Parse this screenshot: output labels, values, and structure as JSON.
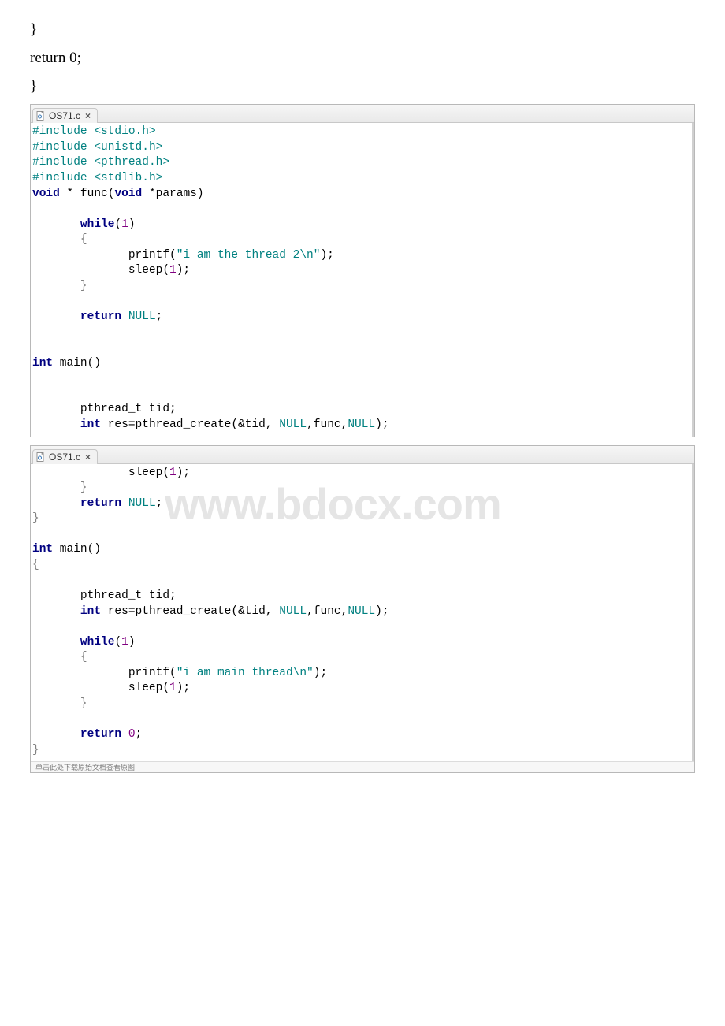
{
  "prose": {
    "line1": "}",
    "line2": "return 0;",
    "line3": "}"
  },
  "tab": {
    "filename": "OS71.c",
    "close_glyph": "×"
  },
  "watermark": "www.bdocx.com",
  "bottom_status": "单击此处下载原始文档查看原图",
  "panel1": {
    "tokens": [
      [
        [
          "pp",
          "#include"
        ],
        [
          "ident",
          " "
        ],
        [
          "hdr",
          "<stdio.h>"
        ]
      ],
      [
        [
          "pp",
          "#include"
        ],
        [
          "ident",
          " "
        ],
        [
          "hdr",
          "<unistd.h>"
        ]
      ],
      [
        [
          "pp",
          "#include"
        ],
        [
          "ident",
          " "
        ],
        [
          "hdr",
          "<pthread.h>"
        ]
      ],
      [
        [
          "pp",
          "#include"
        ],
        [
          "ident",
          " "
        ],
        [
          "hdr",
          "<stdlib.h>"
        ]
      ],
      [
        [
          "kw",
          "void"
        ],
        [
          "ident",
          " * func("
        ],
        [
          "kw",
          "void"
        ],
        [
          "ident",
          " *params)"
        ]
      ],
      [
        [
          "ident",
          ""
        ]
      ],
      [
        [
          "ident",
          "       "
        ],
        [
          "kw",
          "while"
        ],
        [
          "ident",
          "("
        ],
        [
          "num",
          "1"
        ],
        [
          "ident",
          ")"
        ]
      ],
      [
        [
          "ident",
          "       "
        ],
        [
          "brace",
          "{"
        ]
      ],
      [
        [
          "ident",
          "              printf("
        ],
        [
          "str",
          "\"i am the thread 2\\n\""
        ],
        [
          "ident",
          ");"
        ]
      ],
      [
        [
          "ident",
          "              sleep("
        ],
        [
          "num",
          "1"
        ],
        [
          "ident",
          ");"
        ]
      ],
      [
        [
          "ident",
          "       "
        ],
        [
          "brace",
          "}"
        ]
      ],
      [
        [
          "ident",
          ""
        ]
      ],
      [
        [
          "ident",
          "       "
        ],
        [
          "kw",
          "return"
        ],
        [
          "ident",
          " "
        ],
        [
          "nullkw",
          "NULL"
        ],
        [
          "ident",
          ";"
        ]
      ],
      [
        [
          "ident",
          ""
        ]
      ],
      [
        [
          "ident",
          ""
        ]
      ],
      [
        [
          "kw",
          "int"
        ],
        [
          "ident",
          " main()"
        ]
      ],
      [
        [
          "ident",
          ""
        ]
      ],
      [
        [
          "ident",
          ""
        ]
      ],
      [
        [
          "ident",
          "       pthread_t tid;"
        ]
      ],
      [
        [
          "ident",
          "       "
        ],
        [
          "kw",
          "int"
        ],
        [
          "ident",
          " res=pthread_create(&tid, "
        ],
        [
          "nullkw",
          "NULL"
        ],
        [
          "ident",
          ",func,"
        ],
        [
          "nullkw",
          "NULL"
        ],
        [
          "ident",
          ");"
        ]
      ]
    ]
  },
  "panel2": {
    "tokens": [
      [
        [
          "ident",
          "              sleep("
        ],
        [
          "num",
          "1"
        ],
        [
          "ident",
          ");"
        ]
      ],
      [
        [
          "ident",
          "       "
        ],
        [
          "brace",
          "}"
        ]
      ],
      [
        [
          "ident",
          "       "
        ],
        [
          "kw",
          "return"
        ],
        [
          "ident",
          " "
        ],
        [
          "nullkw",
          "NULL"
        ],
        [
          "ident",
          ";"
        ]
      ],
      [
        [
          "brace",
          "}"
        ]
      ],
      [
        [
          "ident",
          ""
        ]
      ],
      [
        [
          "kw",
          "int"
        ],
        [
          "ident",
          " main()"
        ]
      ],
      [
        [
          "brace",
          "{"
        ]
      ],
      [
        [
          "ident",
          ""
        ]
      ],
      [
        [
          "ident",
          "       pthread_t tid;"
        ]
      ],
      [
        [
          "ident",
          "       "
        ],
        [
          "kw",
          "int"
        ],
        [
          "ident",
          " res=pthread_create(&tid, "
        ],
        [
          "nullkw",
          "NULL"
        ],
        [
          "ident",
          ",func,"
        ],
        [
          "nullkw",
          "NULL"
        ],
        [
          "ident",
          ");"
        ]
      ],
      [
        [
          "ident",
          ""
        ]
      ],
      [
        [
          "ident",
          "       "
        ],
        [
          "kw",
          "while"
        ],
        [
          "ident",
          "("
        ],
        [
          "num",
          "1"
        ],
        [
          "ident",
          ")"
        ]
      ],
      [
        [
          "ident",
          "       "
        ],
        [
          "brace",
          "{"
        ]
      ],
      [
        [
          "ident",
          "              printf("
        ],
        [
          "str",
          "\"i am main thread\\n\""
        ],
        [
          "ident",
          ");"
        ]
      ],
      [
        [
          "ident",
          "              sleep("
        ],
        [
          "num",
          "1"
        ],
        [
          "ident",
          ");"
        ]
      ],
      [
        [
          "ident",
          "       "
        ],
        [
          "brace",
          "}"
        ]
      ],
      [
        [
          "ident",
          ""
        ]
      ],
      [
        [
          "ident",
          "       "
        ],
        [
          "kw",
          "return"
        ],
        [
          "ident",
          " "
        ],
        [
          "num",
          "0"
        ],
        [
          "ident",
          ";"
        ]
      ],
      [
        [
          "brace",
          "}"
        ]
      ]
    ]
  }
}
